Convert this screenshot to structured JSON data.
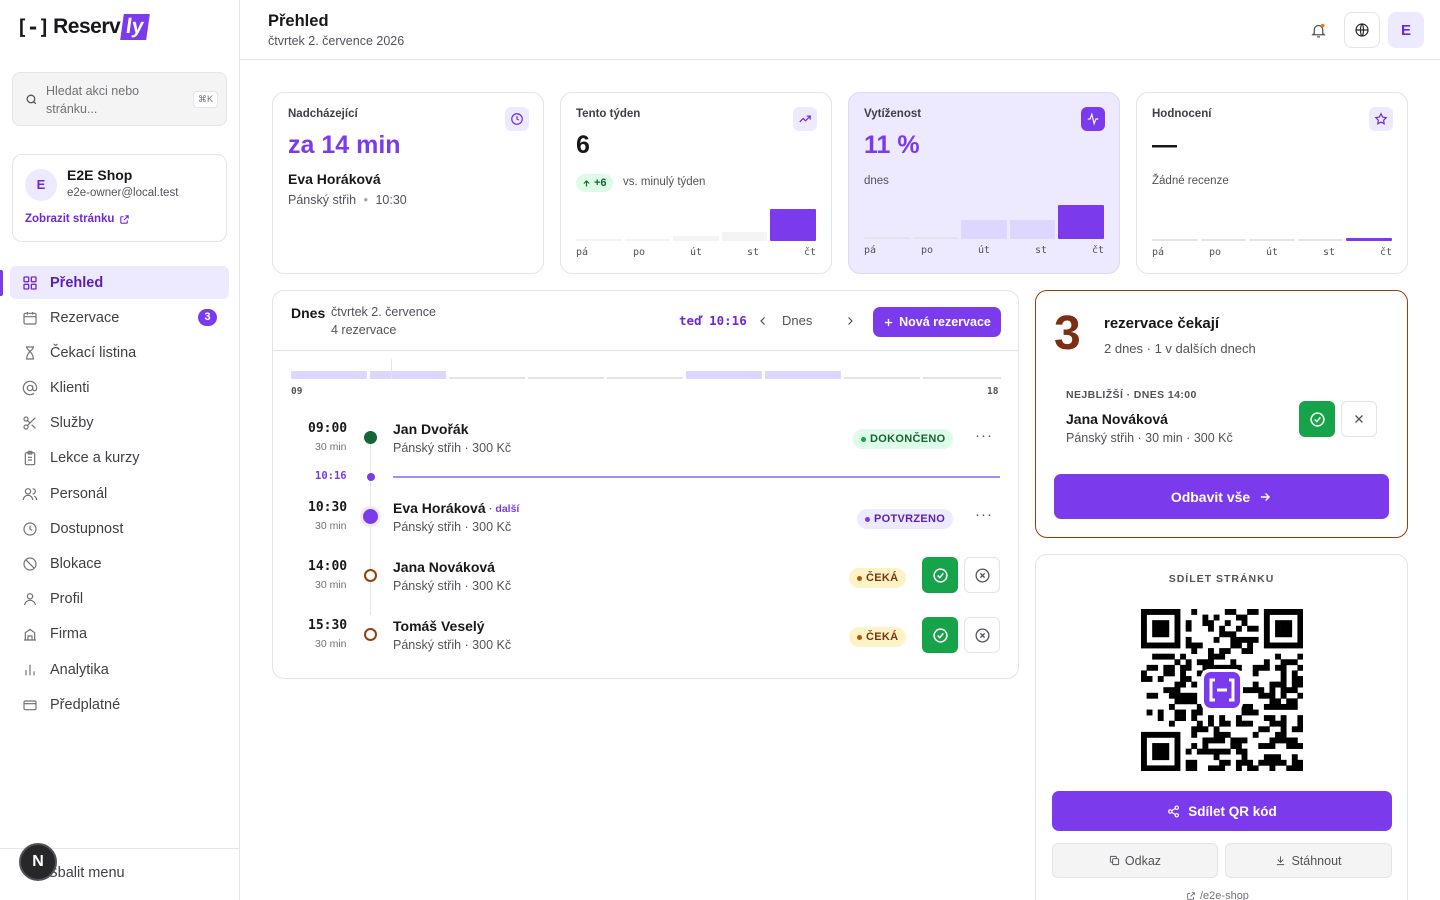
{
  "brand": {
    "name_prefix": "Reserv",
    "name_suffix": "ly"
  },
  "sidebar": {
    "search_placeholder": "Hledat akci nebo stránku...",
    "search_shortcut": "⌘K",
    "shop": {
      "avatar": "E",
      "name": "E2E Shop",
      "email": "e2e-owner@local.test",
      "view_link": "Zobrazit stránku"
    },
    "items": [
      {
        "label": "Přehled",
        "icon": "grid-icon",
        "active": true
      },
      {
        "label": "Rezervace",
        "icon": "calendar-icon",
        "badge": "3"
      },
      {
        "label": "Čekací listina",
        "icon": "hourglass-icon"
      },
      {
        "label": "Klienti",
        "icon": "at-sign-icon"
      },
      {
        "label": "Služby",
        "icon": "scissors-icon"
      },
      {
        "label": "Lekce a kurzy",
        "icon": "clipboard-icon"
      },
      {
        "label": "Personál",
        "icon": "users-icon"
      },
      {
        "label": "Dostupnost",
        "icon": "clock-icon"
      },
      {
        "label": "Blokace",
        "icon": "ban-icon"
      },
      {
        "label": "Profil",
        "icon": "user-icon"
      },
      {
        "label": "Firma",
        "icon": "building-icon"
      },
      {
        "label": "Analytika",
        "icon": "bar-chart-icon"
      },
      {
        "label": "Předplatné",
        "icon": "wallet-icon"
      }
    ],
    "collapse_label": "Sbalit menu",
    "floating_button": "N"
  },
  "header": {
    "title": "Přehled",
    "date": "čtvrtek 2. července 2026",
    "avatar": "E"
  },
  "stats": {
    "upcoming": {
      "label": "Nadcházející",
      "value": "za 14 min",
      "client": "Eva Horáková",
      "service": "Pánský střih",
      "time": "10:30"
    },
    "week": {
      "label": "Tento týden",
      "value": "6",
      "delta": "+6",
      "delta_note": "vs. minulý týden",
      "bars": [
        0.06,
        0.06,
        0.12,
        0.24,
        0.85
      ],
      "days": [
        "pá",
        "po",
        "út",
        "st",
        "čt"
      ]
    },
    "occupancy": {
      "label": "Vytíženost",
      "value": "11 %",
      "note": "dnes",
      "bars": [
        0.06,
        0.06,
        0.5,
        0.5,
        0.9
      ],
      "days": [
        "pá",
        "po",
        "út",
        "st",
        "čt"
      ]
    },
    "rating": {
      "label": "Hodnocení",
      "value": "—",
      "note": "Žádné recenze",
      "bars": [
        0.06,
        0.06,
        0.06,
        0.06,
        0.08
      ],
      "days": [
        "pá",
        "po",
        "út",
        "st",
        "čt"
      ]
    }
  },
  "today": {
    "title": "Dnes",
    "date": "čtvrtek 2. července",
    "count": "4 rezervace",
    "now_label": "teď 10:16",
    "today_button": "Dnes",
    "new_button": "Nová rezervace",
    "range_start": "09",
    "range_end": "18",
    "now_time": "10:16",
    "rows": [
      {
        "time": "09:00",
        "duration": "30 min",
        "name": "Jan Dvořák",
        "service": "Pánský střih · 300 Kč",
        "status": "DOKONČENO",
        "next": ""
      },
      {
        "time": "10:30",
        "duration": "30 min",
        "name": "Eva Horáková",
        "service": "Pánský střih · 300 Kč",
        "status": "POTVRZENO",
        "next": "· další"
      },
      {
        "time": "14:00",
        "duration": "30 min",
        "name": "Jana Nováková",
        "service": "Pánský střih · 300 Kč",
        "status": "ČEKÁ",
        "next": ""
      },
      {
        "time": "15:30",
        "duration": "30 min",
        "name": "Tomáš Veselý",
        "service": "Pánský střih · 300 Kč",
        "status": "ČEKÁ",
        "next": ""
      }
    ]
  },
  "pending": {
    "count": "3",
    "title": "rezervace čekají",
    "subtitle": "2 dnes · 1 v dalších dnech",
    "nearest_label": "NEJBLIŽŠÍ · DNES 14:00",
    "nearest_name": "Jana Nováková",
    "nearest_service": "Pánský střih · 30 min · 300 Kč",
    "clear_button": "Odbavit vše"
  },
  "share": {
    "title": "SDÍLET STRÁNKU",
    "share_button": "Sdílet QR kód",
    "link_button": "Odkaz",
    "download_button": "Stáhnout",
    "url": "/e2e-shop"
  },
  "colors": {
    "accent": "#7c3aed",
    "accent_light": "#ede9fe",
    "success": "#16a34a",
    "warning": "#92400e"
  }
}
